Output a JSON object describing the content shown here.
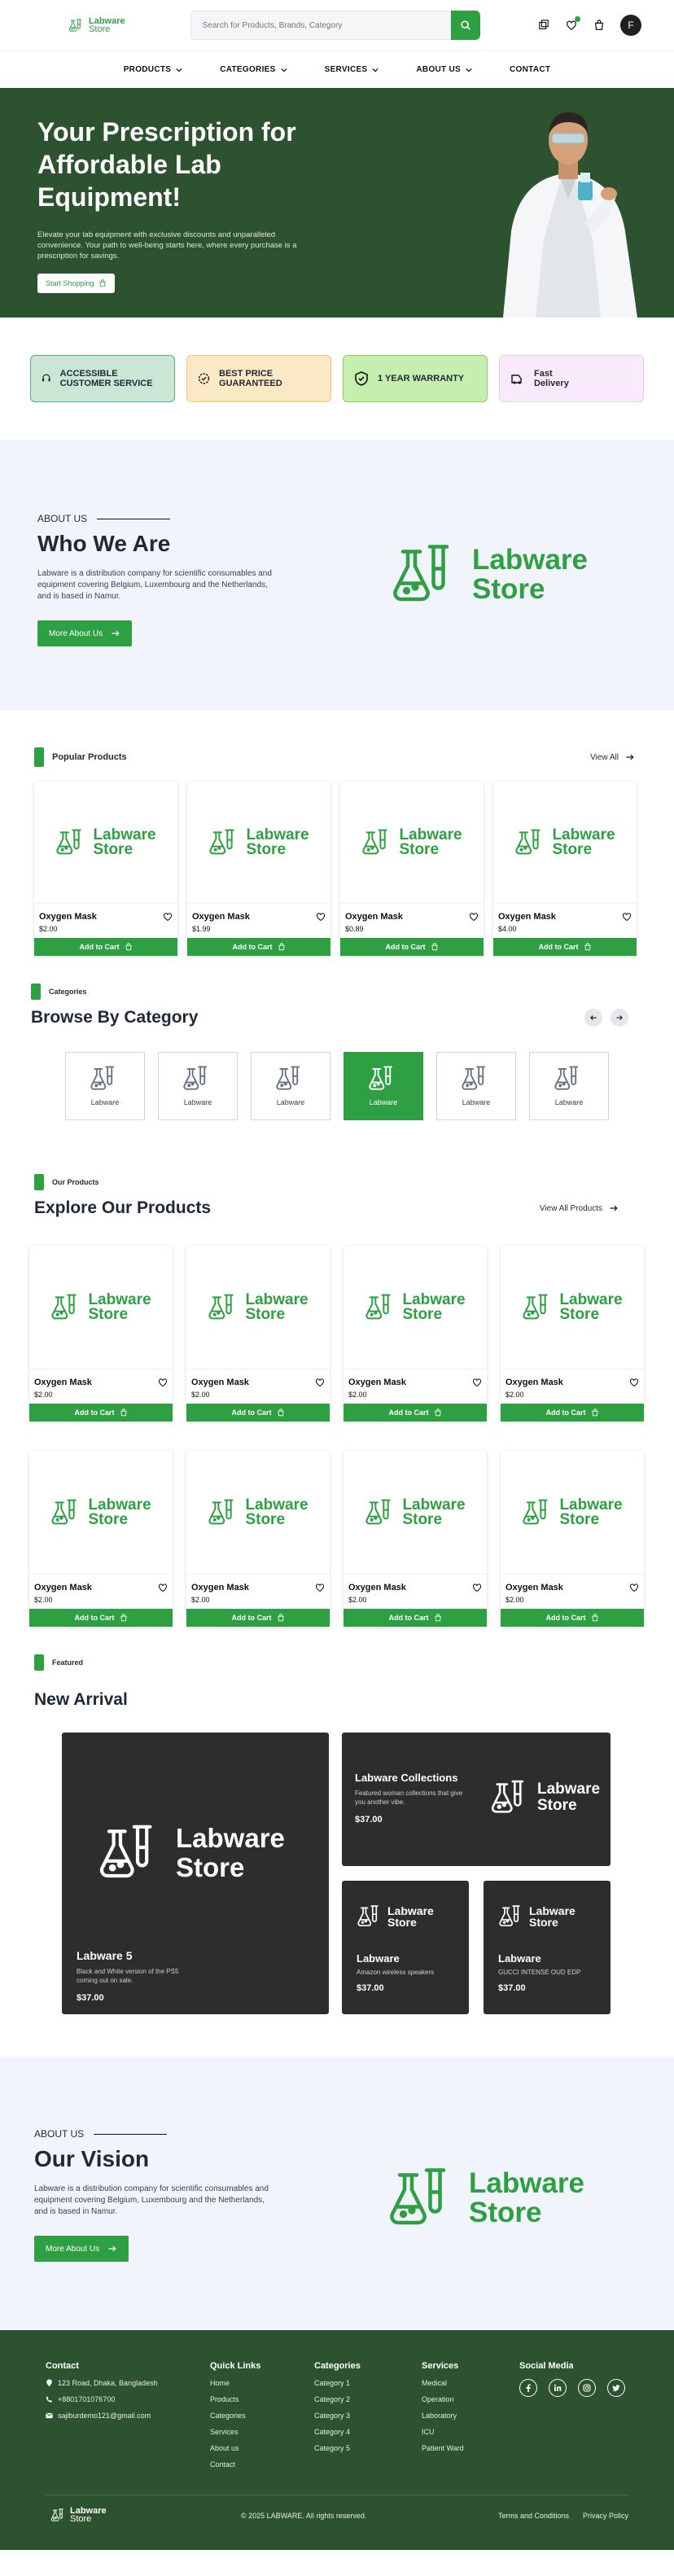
{
  "brand": {
    "line1": "Labware",
    "line2": "Store",
    "color": "#2ea043",
    "dark_green": "#2d5230"
  },
  "search": {
    "placeholder": "Search for Products, Brands, Category"
  },
  "header_icons": [
    "compare-icon",
    "heart-icon",
    "cart-icon"
  ],
  "avatar_letter": "F",
  "nav": [
    {
      "label": "PRODUCTS",
      "dropdown": true
    },
    {
      "label": "CATEGORIES",
      "dropdown": true
    },
    {
      "label": "SERVICES",
      "dropdown": true
    },
    {
      "label": "ABOUT US",
      "dropdown": true
    },
    {
      "label": "CONTACT",
      "dropdown": false
    }
  ],
  "hero": {
    "title": "Your Prescription for Affordable Lab Equipment!",
    "text": "Elevate your lab equipment with exclusive discounts and unparalleled convenience. Your path to well-being starts here, where every purchase is a prescription for savings.",
    "button": "Start Shopping"
  },
  "features": [
    {
      "label": "ACCESSIBLE CUSTOMER SERVICE",
      "bg": "#c9e7d4",
      "border": "#55b276",
      "icon": "headset-icon"
    },
    {
      "label": "BEST PRICE GUARANTEED",
      "bg": "#fbe8c4",
      "border": "#f0c977",
      "icon": "badge-icon"
    },
    {
      "label": "1 YEAR WARRANTY",
      "bg": "#c6eeae",
      "border": "#8bd15c",
      "icon": "shield-icon"
    },
    {
      "label": "Fast Delivery",
      "bg": "#f8e9fb",
      "border": "#ecc9f1",
      "icon": "delivery-icon"
    }
  ],
  "about": {
    "eyebrow": "ABOUT US",
    "title": "Who We Are",
    "text": "Labware is a distribution company for scientific consumables and equipment covering Belgium, Luxembourg and the Netherlands, and is based in Namur.",
    "button": "More About Us"
  },
  "popular": {
    "tag": "Popular Products",
    "view_all": "View All",
    "products": [
      {
        "name": "Oxygen Mask",
        "price": "$2.00"
      },
      {
        "name": "Oxygen Mask",
        "price": "$1.99"
      },
      {
        "name": "Oxygen Mask",
        "price": "$0.89"
      },
      {
        "name": "Oxygen Mask",
        "price": "$4.00"
      }
    ],
    "cart_label": "Add to Cart"
  },
  "categories": {
    "tag": "Categories",
    "title": "Browse By Category",
    "items": [
      "Labware",
      "Labware",
      "Labware",
      "Labware",
      "Labware",
      "Labware"
    ],
    "active_index": 3
  },
  "explore": {
    "tag": "Our Products",
    "title": "Explore Our Products",
    "view_all": "View All Products",
    "products": [
      {
        "name": "Oxygen Mask",
        "price": "$2.00"
      },
      {
        "name": "Oxygen Mask",
        "price": "$2.00"
      },
      {
        "name": "Oxygen Mask",
        "price": "$2.00"
      },
      {
        "name": "Oxygen Mask",
        "price": "$2.00"
      },
      {
        "name": "Oxygen Mask",
        "price": "$2.00"
      },
      {
        "name": "Oxygen Mask",
        "price": "$2.00"
      },
      {
        "name": "Oxygen Mask",
        "price": "$2.00"
      },
      {
        "name": "Oxygen Mask",
        "price": "$2.00"
      }
    ],
    "cart_label": "Add to Cart"
  },
  "arrival": {
    "tag": "Featured",
    "title": "New Arrival",
    "big": {
      "title": "Labware 5",
      "desc": "Black and White version of the PS5 coming out on sale.",
      "price": "$37.00"
    },
    "collections": {
      "title": "Labware Collections",
      "desc": "Featured woman collections that give you another vibe.",
      "price": "$37.00"
    },
    "small1": {
      "title": "Labware",
      "desc": "Amazon wireless speakers",
      "price": "$37.00"
    },
    "small2": {
      "title": "Labware",
      "desc": "GUCCI INTENSE OUD EDP",
      "price": "$37.00"
    }
  },
  "vision": {
    "eyebrow": "ABOUT US",
    "title": "Our Vision",
    "text": "Labware is a distribution company for scientific consumables and equipment covering Belgium, Luxembourg and the Netherlands, and is based in Namur.",
    "button": "More About Us"
  },
  "footer": {
    "contact_title": "Contact",
    "address": "123 Road, Dhaka, Bangladesh",
    "phone": "+8801701076700",
    "email": "sajiburdemo121@gmail.com",
    "quick_title": "Quick Links",
    "quick": [
      "Home",
      "Products",
      "Categories",
      "Services",
      "About us",
      "Contact"
    ],
    "cat_title": "Categories",
    "cats": [
      "Category 1",
      "Category 2",
      "Category 3",
      "Category 4",
      "Category 5"
    ],
    "serv_title": "Services",
    "servs": [
      "Medical",
      "Operation",
      "Laboratory",
      "ICU",
      "Patient Ward"
    ],
    "social_title": "Social Media",
    "social_icons": [
      "facebook-icon",
      "linkedin-icon",
      "instagram-icon",
      "twitter-icon"
    ],
    "copyright": "© 2025 LABWARE. All rights reserved.",
    "terms": "Terms and Conditions",
    "privacy": "Privacy Policy"
  }
}
